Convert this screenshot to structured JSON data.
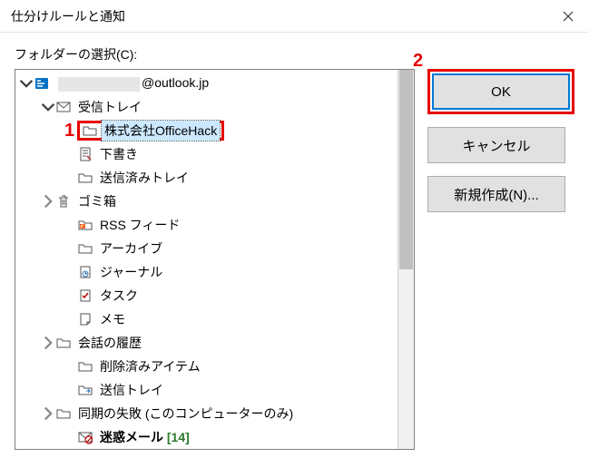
{
  "title": "仕分けルールと通知",
  "label": "フォルダーの選択(C):",
  "account_suffix": "@outlook.jp",
  "tree": {
    "inbox": "受信トレイ",
    "selected_folder": "株式会社OfficeHack",
    "drafts": "下書き",
    "sent": "送信済みトレイ",
    "trash": "ゴミ箱",
    "rss": "RSS フィード",
    "archive": "アーカイブ",
    "journal": "ジャーナル",
    "tasks": "タスク",
    "notes": "メモ",
    "conv": "会話の履歴",
    "deleted": "削除済みアイテム",
    "outbox": "送信トレイ",
    "syncfail": "同期の失敗 (このコンピューターのみ)",
    "junk": "迷惑メール",
    "junk_count": "[14]"
  },
  "buttons": {
    "ok": "OK",
    "cancel": "キャンセル",
    "new": "新規作成(N)..."
  },
  "annotations": {
    "a1": "1",
    "a2": "2"
  }
}
